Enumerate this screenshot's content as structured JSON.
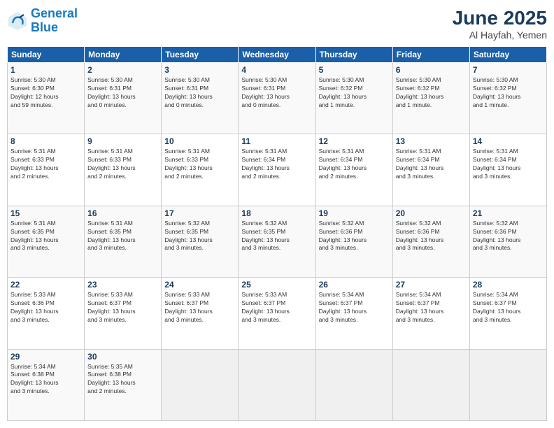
{
  "header": {
    "logo_line1": "General",
    "logo_line2": "Blue",
    "month": "June 2025",
    "location": "Al Hayfah, Yemen"
  },
  "weekdays": [
    "Sunday",
    "Monday",
    "Tuesday",
    "Wednesday",
    "Thursday",
    "Friday",
    "Saturday"
  ],
  "weeks": [
    [
      {
        "day": "1",
        "info": "Sunrise: 5:30 AM\nSunset: 6:30 PM\nDaylight: 12 hours\nand 59 minutes."
      },
      {
        "day": "2",
        "info": "Sunrise: 5:30 AM\nSunset: 6:31 PM\nDaylight: 13 hours\nand 0 minutes."
      },
      {
        "day": "3",
        "info": "Sunrise: 5:30 AM\nSunset: 6:31 PM\nDaylight: 13 hours\nand 0 minutes."
      },
      {
        "day": "4",
        "info": "Sunrise: 5:30 AM\nSunset: 6:31 PM\nDaylight: 13 hours\nand 0 minutes."
      },
      {
        "day": "5",
        "info": "Sunrise: 5:30 AM\nSunset: 6:32 PM\nDaylight: 13 hours\nand 1 minute."
      },
      {
        "day": "6",
        "info": "Sunrise: 5:30 AM\nSunset: 6:32 PM\nDaylight: 13 hours\nand 1 minute."
      },
      {
        "day": "7",
        "info": "Sunrise: 5:30 AM\nSunset: 6:32 PM\nDaylight: 13 hours\nand 1 minute."
      }
    ],
    [
      {
        "day": "8",
        "info": "Sunrise: 5:31 AM\nSunset: 6:33 PM\nDaylight: 13 hours\nand 2 minutes."
      },
      {
        "day": "9",
        "info": "Sunrise: 5:31 AM\nSunset: 6:33 PM\nDaylight: 13 hours\nand 2 minutes."
      },
      {
        "day": "10",
        "info": "Sunrise: 5:31 AM\nSunset: 6:33 PM\nDaylight: 13 hours\nand 2 minutes."
      },
      {
        "day": "11",
        "info": "Sunrise: 5:31 AM\nSunset: 6:34 PM\nDaylight: 13 hours\nand 2 minutes."
      },
      {
        "day": "12",
        "info": "Sunrise: 5:31 AM\nSunset: 6:34 PM\nDaylight: 13 hours\nand 2 minutes."
      },
      {
        "day": "13",
        "info": "Sunrise: 5:31 AM\nSunset: 6:34 PM\nDaylight: 13 hours\nand 3 minutes."
      },
      {
        "day": "14",
        "info": "Sunrise: 5:31 AM\nSunset: 6:34 PM\nDaylight: 13 hours\nand 3 minutes."
      }
    ],
    [
      {
        "day": "15",
        "info": "Sunrise: 5:31 AM\nSunset: 6:35 PM\nDaylight: 13 hours\nand 3 minutes."
      },
      {
        "day": "16",
        "info": "Sunrise: 5:31 AM\nSunset: 6:35 PM\nDaylight: 13 hours\nand 3 minutes."
      },
      {
        "day": "17",
        "info": "Sunrise: 5:32 AM\nSunset: 6:35 PM\nDaylight: 13 hours\nand 3 minutes."
      },
      {
        "day": "18",
        "info": "Sunrise: 5:32 AM\nSunset: 6:35 PM\nDaylight: 13 hours\nand 3 minutes."
      },
      {
        "day": "19",
        "info": "Sunrise: 5:32 AM\nSunset: 6:36 PM\nDaylight: 13 hours\nand 3 minutes."
      },
      {
        "day": "20",
        "info": "Sunrise: 5:32 AM\nSunset: 6:36 PM\nDaylight: 13 hours\nand 3 minutes."
      },
      {
        "day": "21",
        "info": "Sunrise: 5:32 AM\nSunset: 6:36 PM\nDaylight: 13 hours\nand 3 minutes."
      }
    ],
    [
      {
        "day": "22",
        "info": "Sunrise: 5:33 AM\nSunset: 6:36 PM\nDaylight: 13 hours\nand 3 minutes."
      },
      {
        "day": "23",
        "info": "Sunrise: 5:33 AM\nSunset: 6:37 PM\nDaylight: 13 hours\nand 3 minutes."
      },
      {
        "day": "24",
        "info": "Sunrise: 5:33 AM\nSunset: 6:37 PM\nDaylight: 13 hours\nand 3 minutes."
      },
      {
        "day": "25",
        "info": "Sunrise: 5:33 AM\nSunset: 6:37 PM\nDaylight: 13 hours\nand 3 minutes."
      },
      {
        "day": "26",
        "info": "Sunrise: 5:34 AM\nSunset: 6:37 PM\nDaylight: 13 hours\nand 3 minutes."
      },
      {
        "day": "27",
        "info": "Sunrise: 5:34 AM\nSunset: 6:37 PM\nDaylight: 13 hours\nand 3 minutes."
      },
      {
        "day": "28",
        "info": "Sunrise: 5:34 AM\nSunset: 6:37 PM\nDaylight: 13 hours\nand 3 minutes."
      }
    ],
    [
      {
        "day": "29",
        "info": "Sunrise: 5:34 AM\nSunset: 6:38 PM\nDaylight: 13 hours\nand 3 minutes."
      },
      {
        "day": "30",
        "info": "Sunrise: 5:35 AM\nSunset: 6:38 PM\nDaylight: 13 hours\nand 2 minutes."
      },
      {
        "day": "",
        "info": ""
      },
      {
        "day": "",
        "info": ""
      },
      {
        "day": "",
        "info": ""
      },
      {
        "day": "",
        "info": ""
      },
      {
        "day": "",
        "info": ""
      }
    ]
  ]
}
